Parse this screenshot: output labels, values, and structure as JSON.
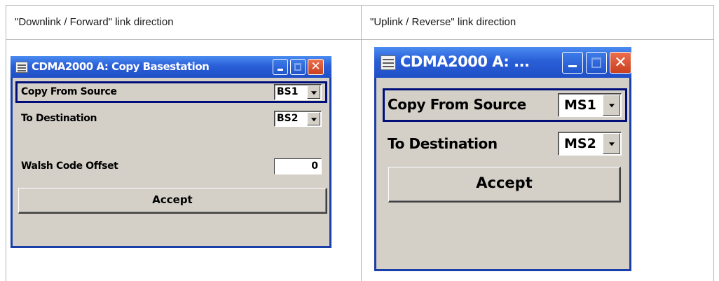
{
  "table": {
    "col1_header": "\"Downlink / Forward\" link direction",
    "col2_header": "\"Uplink / Reverse\" link direction"
  },
  "dialog_downlink": {
    "title": "CDMA2000 A: Copy Basestation",
    "title_icon": "window-menu-icon",
    "copy_from_label": "Copy From Source",
    "copy_from_value": "BS1",
    "to_destination_label": "To Destination",
    "to_destination_value": "BS2",
    "walsh_label": "Walsh Code Offset",
    "walsh_value": "0",
    "accept_label": "Accept"
  },
  "dialog_uplink": {
    "title": "CDMA2000 A: ...",
    "title_icon": "window-menu-icon",
    "copy_from_label": "Copy From Source",
    "copy_from_value": "MS1",
    "to_destination_label": "To Destination",
    "to_destination_value": "MS2",
    "accept_label": "Accept"
  },
  "colors": {
    "titlebar": "#2a5fd8",
    "window_face": "#d4d0c8",
    "focus_frame": "#000e7a",
    "close_button": "#d94f2b"
  }
}
